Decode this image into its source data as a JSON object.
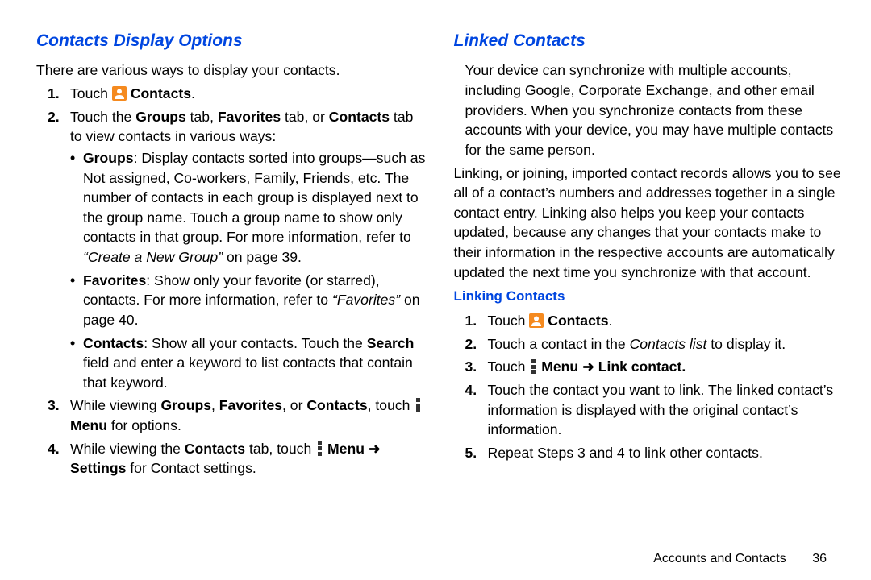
{
  "left": {
    "heading": "Contacts Display Options",
    "intro": "There are various ways to display your contacts.",
    "step1_pre": "Touch ",
    "step1_boldlabel": "Contacts",
    "step1_post": ".",
    "step2_a": "Touch the ",
    "step2_b": "Groups",
    "step2_c": " tab, ",
    "step2_d": "Favorites",
    "step2_e": " tab, or ",
    "step2_f": "Contacts",
    "step2_g": " tab to view contacts in various ways:",
    "bul1_head": "Groups",
    "bul1_body": ": Display contacts sorted into groups—such as Not assigned, Co-workers, Family, Friends, etc. The number of contacts in each group is displayed next to the group name. Touch a group name to show only contacts in that group. For more information, refer to ",
    "bul1_ref": "“Create a New Group”",
    "bul1_tail": " on page 39.",
    "bul2_head": "Favorites",
    "bul2_body": ": Show only your favorite (or starred), contacts. For more information, refer to ",
    "bul2_ref": "“Favorites”",
    "bul2_tail": " on page 40.",
    "bul3_head": "Contacts",
    "bul3_body_a": ": Show all your contacts. Touch the ",
    "bul3_body_b": "Search",
    "bul3_body_c": " field and enter a keyword to list contacts that contain that keyword.",
    "step3_a": "While viewing ",
    "step3_b": "Groups",
    "step3_c": ", ",
    "step3_d": "Favorites",
    "step3_e": ", or ",
    "step3_f": "Contacts",
    "step3_g": ", touch ",
    "step3_menu": "Menu",
    "step3_h": " for options.",
    "step4_a": "While viewing the ",
    "step4_b": "Contacts",
    "step4_c": " tab, touch ",
    "step4_menu": "Menu ",
    "step4_arrow": "➜ ",
    "step4_d": "Settings",
    "step4_e": " for Contact settings."
  },
  "right": {
    "heading": "Linked Contacts",
    "para1": "Your device can synchronize with multiple accounts, including Google, Corporate Exchange, and other email providers. When you synchronize contacts from these accounts with your device, you may have multiple contacts for the same person.",
    "para2": "Linking, or joining, imported contact records allows you to see all of a contact’s numbers and addresses together in a single contact entry. Linking also helps you keep your contacts updated, because any changes that your contacts make to their information in the respective accounts are automatically updated the next time you synchronize with that account.",
    "sub": "Linking Contacts",
    "s1_pre": "Touch ",
    "s1_bold": "Contacts",
    "s1_post": ".",
    "s2_a": "Touch a contact in the ",
    "s2_b": "Contacts list",
    "s2_c": " to display it.",
    "s3_pre": "Touch ",
    "s3_menu": "Menu ",
    "s3_arrow": "➜ ",
    "s3_link": "Link contact.",
    "s4": "Touch the contact you want to link. The linked contact’s information is displayed with the original contact’s information.",
    "s5": "Repeat Steps 3 and 4 to link other contacts."
  },
  "footer": {
    "section": "Accounts and Contacts",
    "page": "36"
  }
}
